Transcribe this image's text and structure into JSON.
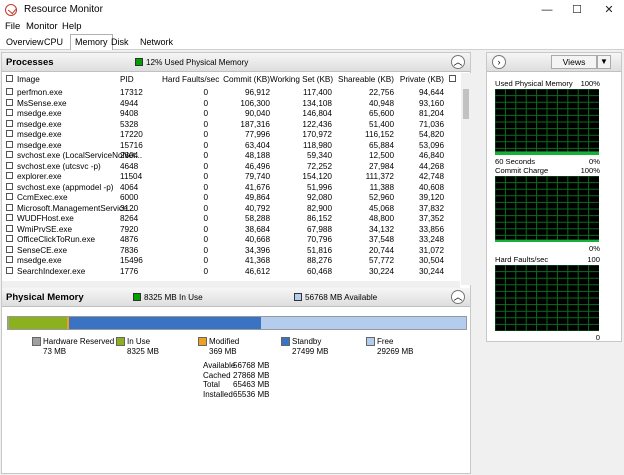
{
  "window": {
    "title": "Resource Monitor",
    "minimize": "—",
    "maximize": "☐",
    "close": "✕"
  },
  "menu": [
    "File",
    "Monitor",
    "Help"
  ],
  "tabs": [
    "Overview",
    "CPU",
    "Memory",
    "Disk",
    "Network"
  ],
  "active_tab": "Memory",
  "processes": {
    "title": "Processes",
    "summary": "12% Used Physical Memory",
    "summary_color": "#00a000",
    "columns": [
      "Image",
      "PID",
      "Hard Faults/sec",
      "Commit (KB)",
      "Working Set (KB)",
      "Shareable (KB)",
      "Private (KB)"
    ],
    "rows": [
      [
        "perfmon.exe",
        "17312",
        "0",
        "96,912",
        "117,400",
        "22,756",
        "94,644"
      ],
      [
        "MsSense.exe",
        "4944",
        "0",
        "106,300",
        "134,108",
        "40,948",
        "93,160"
      ],
      [
        "msedge.exe",
        "9408",
        "0",
        "90,040",
        "146,804",
        "65,600",
        "81,204"
      ],
      [
        "msedge.exe",
        "5328",
        "0",
        "187,316",
        "122,436",
        "51,400",
        "71,036"
      ],
      [
        "msedge.exe",
        "17220",
        "0",
        "77,996",
        "170,972",
        "116,152",
        "54,820"
      ],
      [
        "msedge.exe",
        "15716",
        "0",
        "63,404",
        "118,980",
        "65,884",
        "53,096"
      ],
      [
        "svchost.exe (LocalServiceNoNet...",
        "2804",
        "0",
        "48,188",
        "59,340",
        "12,500",
        "46,840"
      ],
      [
        "svchost.exe (utcsvc -p)",
        "4648",
        "0",
        "46,496",
        "72,252",
        "27,984",
        "44,268"
      ],
      [
        "explorer.exe",
        "11504",
        "0",
        "79,740",
        "154,120",
        "111,372",
        "42,748"
      ],
      [
        "svchost.exe (appmodel -p)",
        "4064",
        "0",
        "41,676",
        "51,996",
        "11,388",
        "40,608"
      ],
      [
        "CcmExec.exe",
        "6000",
        "0",
        "49,864",
        "92,080",
        "52,960",
        "39,120"
      ],
      [
        "Microsoft.ManagementService...",
        "3120",
        "0",
        "40,792",
        "82,900",
        "45,068",
        "37,832"
      ],
      [
        "WUDFHost.exe",
        "8264",
        "0",
        "58,288",
        "86,152",
        "48,800",
        "37,352"
      ],
      [
        "WmiPrvSE.exe",
        "7920",
        "0",
        "38,684",
        "67,988",
        "34,132",
        "33,856"
      ],
      [
        "OfficeClickToRun.exe",
        "4876",
        "0",
        "40,668",
        "70,796",
        "37,548",
        "33,248"
      ],
      [
        "SenseCE.exe",
        "7836",
        "0",
        "34,396",
        "51,816",
        "20,744",
        "31,072"
      ],
      [
        "msedge.exe",
        "15496",
        "0",
        "41,368",
        "88,276",
        "57,772",
        "30,504"
      ],
      [
        "SearchIndexer.exe",
        "1776",
        "0",
        "46,612",
        "60,468",
        "30,224",
        "30,244"
      ]
    ]
  },
  "physical_memory": {
    "title": "Physical Memory",
    "in_use": "8325 MB In Use",
    "available": "56768 MB Available",
    "bar_fractions": {
      "hardware_reserved": 0.0011,
      "in_use": 0.1272,
      "modified": 0.0056,
      "standby": 0.42,
      "free": 0.4471
    },
    "legend": [
      {
        "label": "Hardware Reserved",
        "value": "73 MB",
        "color": "#a0a0a0"
      },
      {
        "label": "In Use",
        "value": "8325 MB",
        "color": "#8cb11e"
      },
      {
        "label": "Modified",
        "value": "369 MB",
        "color": "#f0a020"
      },
      {
        "label": "Standby",
        "value": "27499 MB",
        "color": "#3a72c4"
      },
      {
        "label": "Free",
        "value": "29269 MB",
        "color": "#b4cdee"
      }
    ],
    "stats": [
      {
        "label": "Available",
        "value": "56768 MB"
      },
      {
        "label": "Cached",
        "value": "27868 MB"
      },
      {
        "label": "Total",
        "value": "65463 MB"
      },
      {
        "label": "Installed",
        "value": "65536 MB"
      }
    ]
  },
  "right_panel": {
    "views_label": "Views",
    "graphs": [
      {
        "title": "Used Physical Memory",
        "max": "100%",
        "left_bottom": "60 Seconds",
        "right_bottom": "0%",
        "level": 0.12
      },
      {
        "title": "Commit Charge",
        "max": "100%",
        "left_bottom": "",
        "right_bottom": "0%",
        "level": 0.08
      },
      {
        "title": "Hard Faults/sec",
        "max": "100",
        "left_bottom": "",
        "right_bottom": "0",
        "level": 0.0
      }
    ]
  }
}
